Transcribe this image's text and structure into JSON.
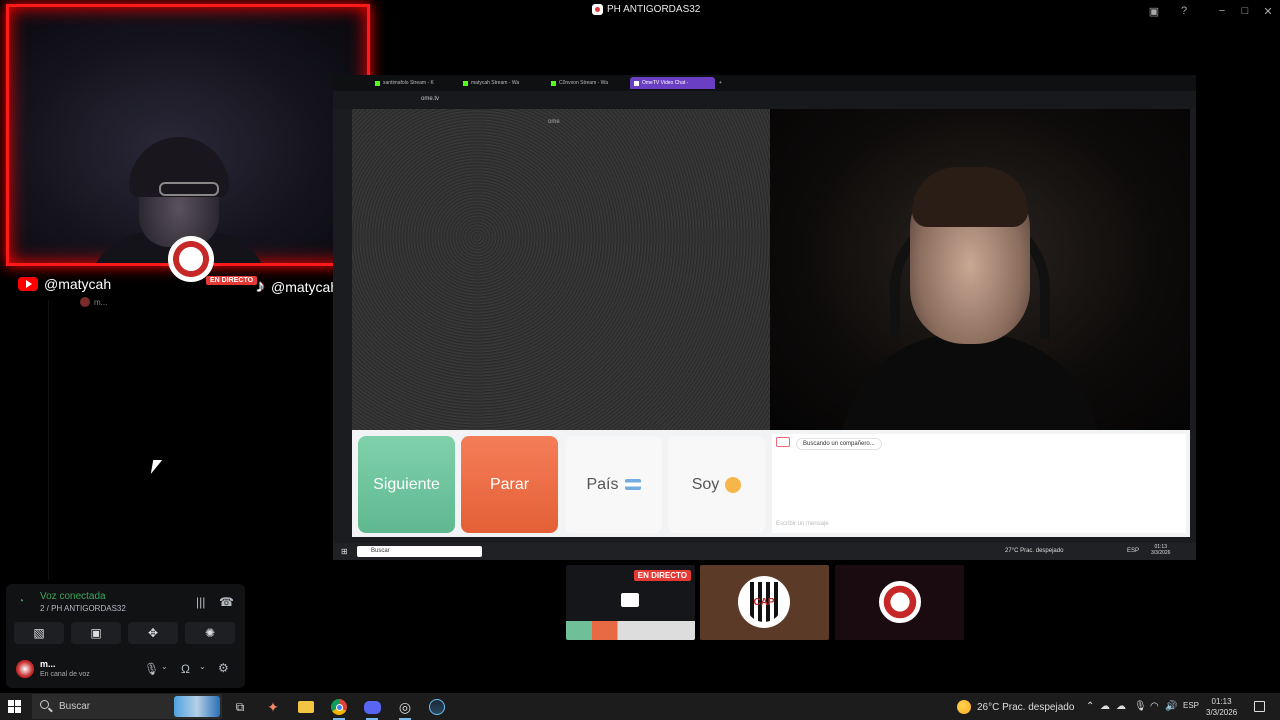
{
  "window": {
    "title": "PH ANTIGORDAS32",
    "controls": [
      "−",
      "□",
      "✕"
    ]
  },
  "stream_overlay": {
    "youtube_handle": "@matycah",
    "tiktok_handle": "@matycah",
    "live_label": "EN DIRECTO",
    "mini_user": "m..."
  },
  "discord": {
    "voice_status": "Voz conectada",
    "voice_channel": "2 / PH ANTIGORDAS32",
    "user_name": "m...",
    "user_status": "En canal de voz",
    "accent_color": "#3ba55c"
  },
  "browser": {
    "tabs": [
      {
        "label": "xantimafolo Stream - K"
      },
      {
        "label": "matycah Stream - Wa"
      },
      {
        "label": "C0nvxon Stream - Wa"
      },
      {
        "label": "OmeTV Video Chat -"
      }
    ],
    "url": "ome.tv"
  },
  "ometv": {
    "video_logo": "ome",
    "next_label": "Siguiente",
    "stop_label": "Parar",
    "country_label": "País",
    "iam_label": "Soy",
    "chat_status": "Buscando un compañero...",
    "chat_placeholder": "Escribir un mensaje",
    "next_color": "#6fc89d",
    "stop_color": "#ec6b43"
  },
  "inner_taskbar": {
    "search": "Buscar",
    "weather": "27°C Prac. despejado",
    "lang": "ESP",
    "time": "01:13",
    "date": "3/3/2026"
  },
  "thumbnails": {
    "live_label": "EN DIRECTO",
    "crest_text": "CAP"
  },
  "taskbar": {
    "search_label": "Buscar",
    "weather": "26°C  Prac. despejado",
    "lang": "ESP",
    "time": "01:13",
    "date": "3/3/2026"
  }
}
